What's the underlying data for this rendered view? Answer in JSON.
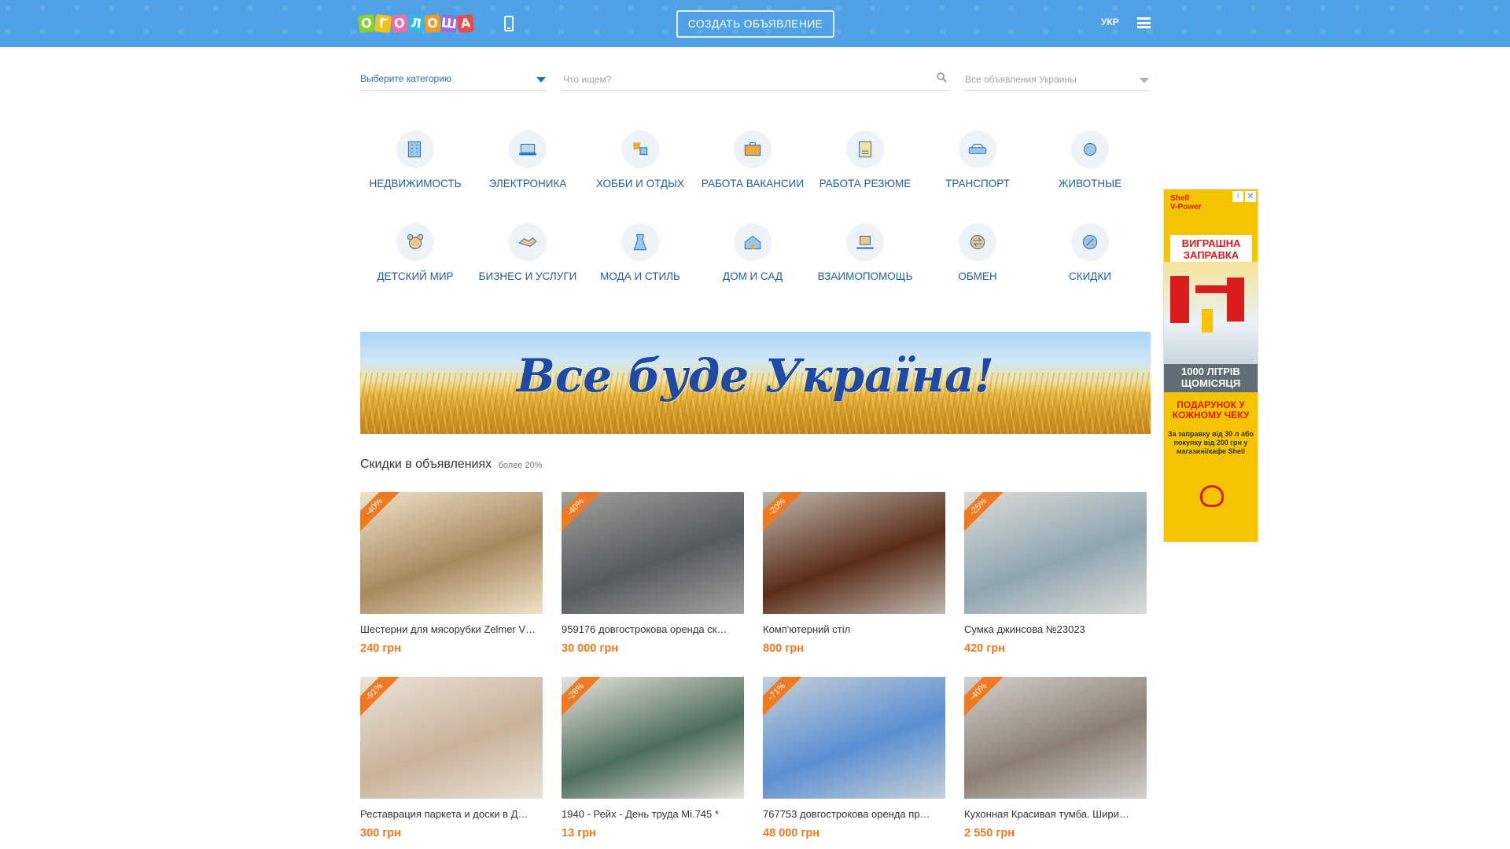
{
  "header": {
    "logo_letters": [
      "О",
      "Г",
      "О",
      "Л",
      "О",
      "Ш",
      "А"
    ],
    "logo_colors": [
      "#8ad12c",
      "#f0c419",
      "#ef6cb0",
      "#2eb9e8",
      "#f39a1e",
      "#9c6be0",
      "#e94b4b"
    ],
    "create_button": "СОЗДАТЬ ОБЪЯВЛЕНИЕ",
    "language": "УКР"
  },
  "search": {
    "category_placeholder": "Выберите категорию",
    "query_placeholder": "Что ищем?",
    "region_placeholder": "Все объявления Украины"
  },
  "categories": [
    {
      "label": "НЕДВИЖИМОСТЬ",
      "icon": "building-icon"
    },
    {
      "label": "ЭЛЕКТРОНИКА",
      "icon": "laptop-icon"
    },
    {
      "label": "ХОББИ И ОТДЫХ",
      "icon": "puzzle-icon"
    },
    {
      "label": "РАБОТА ВАКАНСИИ",
      "icon": "briefcase-icon"
    },
    {
      "label": "РАБОТА РЕЗЮМЕ",
      "icon": "resume-icon"
    },
    {
      "label": "ТРАНСПОРТ",
      "icon": "car-icon"
    },
    {
      "label": "ЖИВОТНЫЕ",
      "icon": "pets-icon"
    },
    {
      "label": "ДЕТСКИЙ МИР",
      "icon": "teddy-bear-icon"
    },
    {
      "label": "БИЗНЕС И УСЛУГИ",
      "icon": "handshake-icon"
    },
    {
      "label": "МОДА И СТИЛЬ",
      "icon": "dress-icon"
    },
    {
      "label": "ДОМ И САД",
      "icon": "house-garden-icon"
    },
    {
      "label": "ВЗАИМОПОМОЩЬ",
      "icon": "gift-hand-icon"
    },
    {
      "label": "ОБМЕН",
      "icon": "exchange-icon"
    },
    {
      "label": "СКИДКИ",
      "icon": "percent-icon"
    }
  ],
  "banner": {
    "slogan": "Все буде Україна!"
  },
  "discounts": {
    "title": "Скидки в объявлениях",
    "subtitle": "более 20%",
    "items": [
      {
        "badge": "-40%",
        "title": "Шестерни для мясорубки Zelmer V…",
        "price": "240 грн",
        "colors": [
          "#a8895e",
          "#efe3c9"
        ]
      },
      {
        "badge": "-40%",
        "title": "959176 довгострокова оренда ск…",
        "price": "30 000 грн",
        "colors": [
          "#545a5e",
          "#a3a29c"
        ]
      },
      {
        "badge": "-20%",
        "title": "Комп'ютерний стіл",
        "price": "800 грн",
        "colors": [
          "#5a2d18",
          "#bfb8ae"
        ]
      },
      {
        "badge": "-25%",
        "title": "Сумка джинсова №23023",
        "price": "420 грн",
        "colors": [
          "#8fa6b2",
          "#dcdcd6"
        ]
      },
      {
        "badge": "-91%",
        "title": "Реставрация паркета и доски в Д…",
        "price": "300 грн",
        "colors": [
          "#c9b39a",
          "#eae3d8"
        ]
      },
      {
        "badge": "-28%",
        "title": "1940 - Рейх - День труда Mi.745 *",
        "price": "13 грн",
        "colors": [
          "#4c6d5c",
          "#e8e4da"
        ]
      },
      {
        "badge": "-71%",
        "title": "767753 довгострокова оренда пр…",
        "price": "48 000 грн",
        "colors": [
          "#5a8fd3",
          "#c7d0d6"
        ]
      },
      {
        "badge": "-40%",
        "title": "Кухонная Красивая тумба. Шири…",
        "price": "2 550 грн",
        "colors": [
          "#8b7f73",
          "#d4d1cc"
        ]
      }
    ]
  },
  "ad": {
    "brand_line1": "Shell",
    "brand_line2": "V-Power",
    "headline": "ВИГРАШНА ЗАПРАВКА",
    "mid": "1000 ЛІТРІВ ЩОМІСЯЦЯ",
    "gift_title": "ПОДАРУНОК У КОЖНОМУ ЧЕКУ",
    "gift_text": "За заправку від 30 л або покупку від 200 грн у магазині/кафе Shell",
    "info_symbol": "i",
    "close_symbol": "✕"
  }
}
